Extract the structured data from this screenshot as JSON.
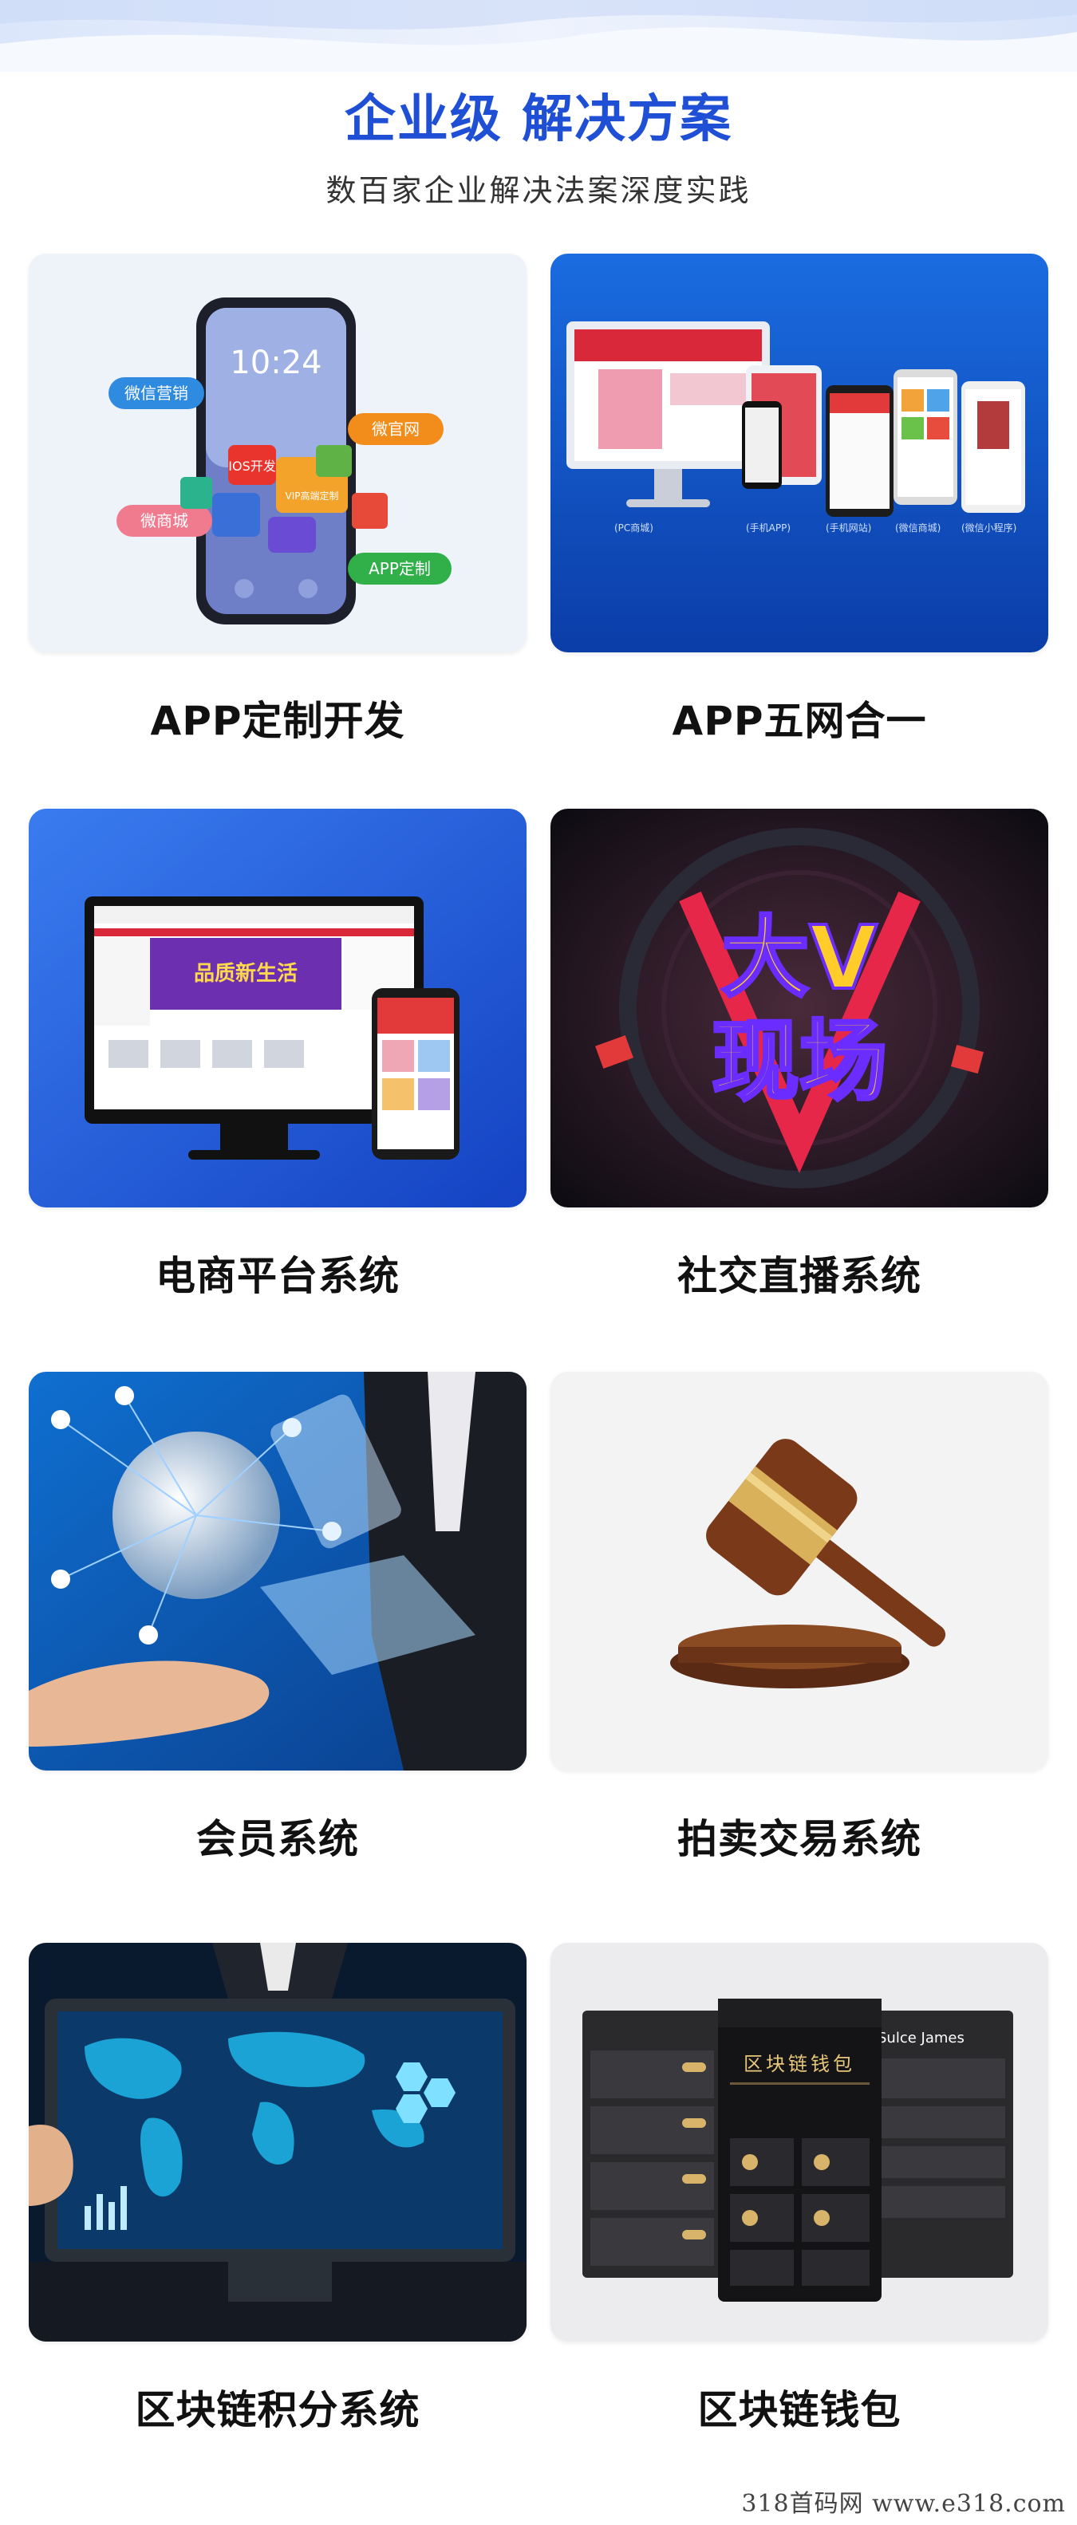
{
  "page": {
    "title": "企业级 解决方案",
    "subtitle": "数百家企业解决法案深度实践"
  },
  "solutions": [
    {
      "label": "APP定制开发",
      "icon": "phone-app-icon",
      "tags": [
        "微信营销",
        "微官网",
        "微商城",
        "APP定制",
        "IOS开发",
        "VIP高端定制"
      ],
      "phone_time": "10:24"
    },
    {
      "label": "APP五网合一",
      "icon": "multi-device-icon",
      "captions": [
        "(PC商城)",
        "(手机APP)",
        "(手机网站)",
        "(微信商城)",
        "(微信小程序)"
      ]
    },
    {
      "label": "电商平台系统",
      "icon": "ecommerce-icon",
      "banner": "品质新生活"
    },
    {
      "label": "社交直播系统",
      "icon": "live-stream-icon",
      "logo": "大V现场"
    },
    {
      "label": "会员系统",
      "icon": "member-network-icon"
    },
    {
      "label": "拍卖交易系统",
      "icon": "gavel-icon"
    },
    {
      "label": "区块链积分系统",
      "icon": "blockchain-map-icon"
    },
    {
      "label": "区块链钱包",
      "icon": "wallet-app-icon",
      "app_title": "区块链钱包",
      "user": "Sulce James"
    }
  ],
  "watermark": "318首码网  www.e318.com",
  "colors": {
    "accent": "#1f4fd4",
    "text": "#111111",
    "subtext": "#333333"
  }
}
